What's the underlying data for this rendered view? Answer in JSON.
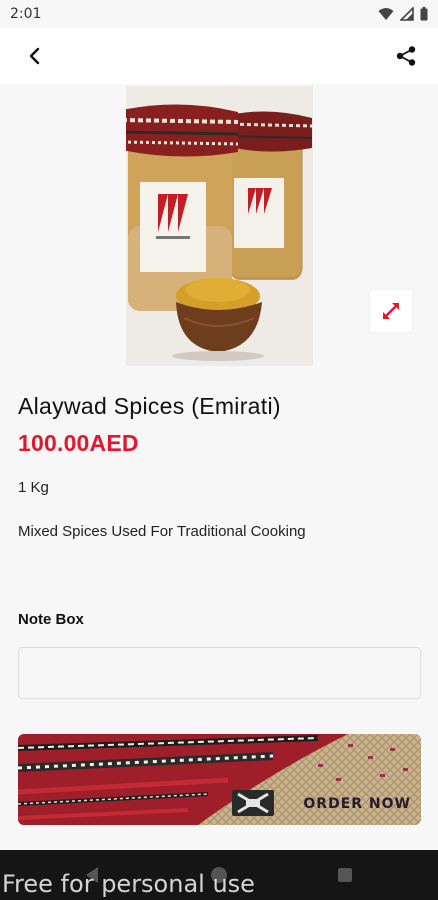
{
  "status_bar": {
    "time": "2:01",
    "icons": [
      "wifi-icon",
      "signal-icon",
      "battery-icon"
    ]
  },
  "app_bar": {
    "back_icon": "back-arrow-icon",
    "share_icon": "share-icon"
  },
  "product": {
    "image_icon": "expand-icon",
    "title": "Alaywad Spices (Emirati)",
    "price": "100.00AED",
    "weight": "1 Kg",
    "description": "Mixed Spices Used For Traditional Cooking"
  },
  "note": {
    "label": "Note Box",
    "value": "",
    "placeholder": ""
  },
  "banner": {
    "order_label": "ORDER NOW"
  },
  "watermark": "Free for personal use",
  "colors": {
    "accent": "#e0182d",
    "nav_bar": "#151515",
    "background": "#f7f7f7"
  }
}
